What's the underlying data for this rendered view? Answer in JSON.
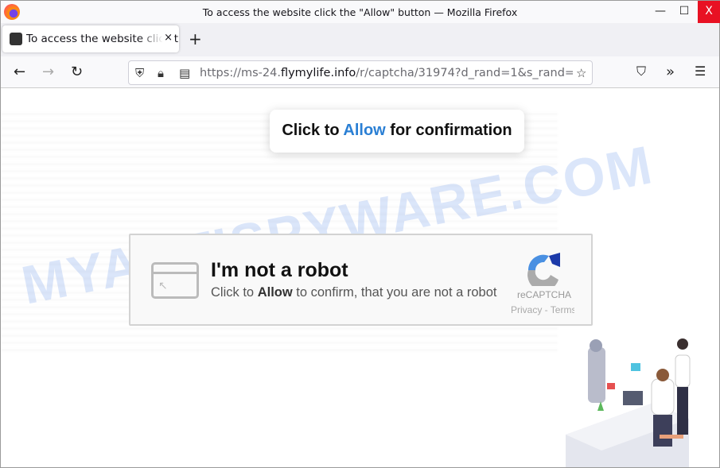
{
  "window": {
    "title": "To access the website click the \"Allow\" button — Mozilla Firefox",
    "minimize": "—",
    "maximize": "☐",
    "close": "X"
  },
  "tab": {
    "label": "To access the website click the \"Allow\" button",
    "close": "×",
    "new_tab": "+"
  },
  "nav": {
    "back": "←",
    "forward": "→",
    "reload": "↻",
    "url_prefix": "https://ms-24.",
    "url_domain": "flymylife.info",
    "url_path": "/r/captcha/31974?d_rand=1&s_rand=",
    "pocket": "⛉",
    "extensions": "»",
    "menu": "☰"
  },
  "page": {
    "watermark": "MYANTISPYWARE.COM",
    "confirm": {
      "pre": "Click to ",
      "allow": "Allow",
      "post": " for confirmation"
    },
    "captcha": {
      "title": "I'm not a robot",
      "sub_pre": "Click to ",
      "sub_bold": "Allow",
      "sub_post": " to confirm, that you are not a robot",
      "brand": "reCAPTCHA",
      "links": "Privacy - Terms"
    }
  },
  "colors": {
    "accent": "#2a7fd4",
    "close_btn": "#e81123"
  }
}
